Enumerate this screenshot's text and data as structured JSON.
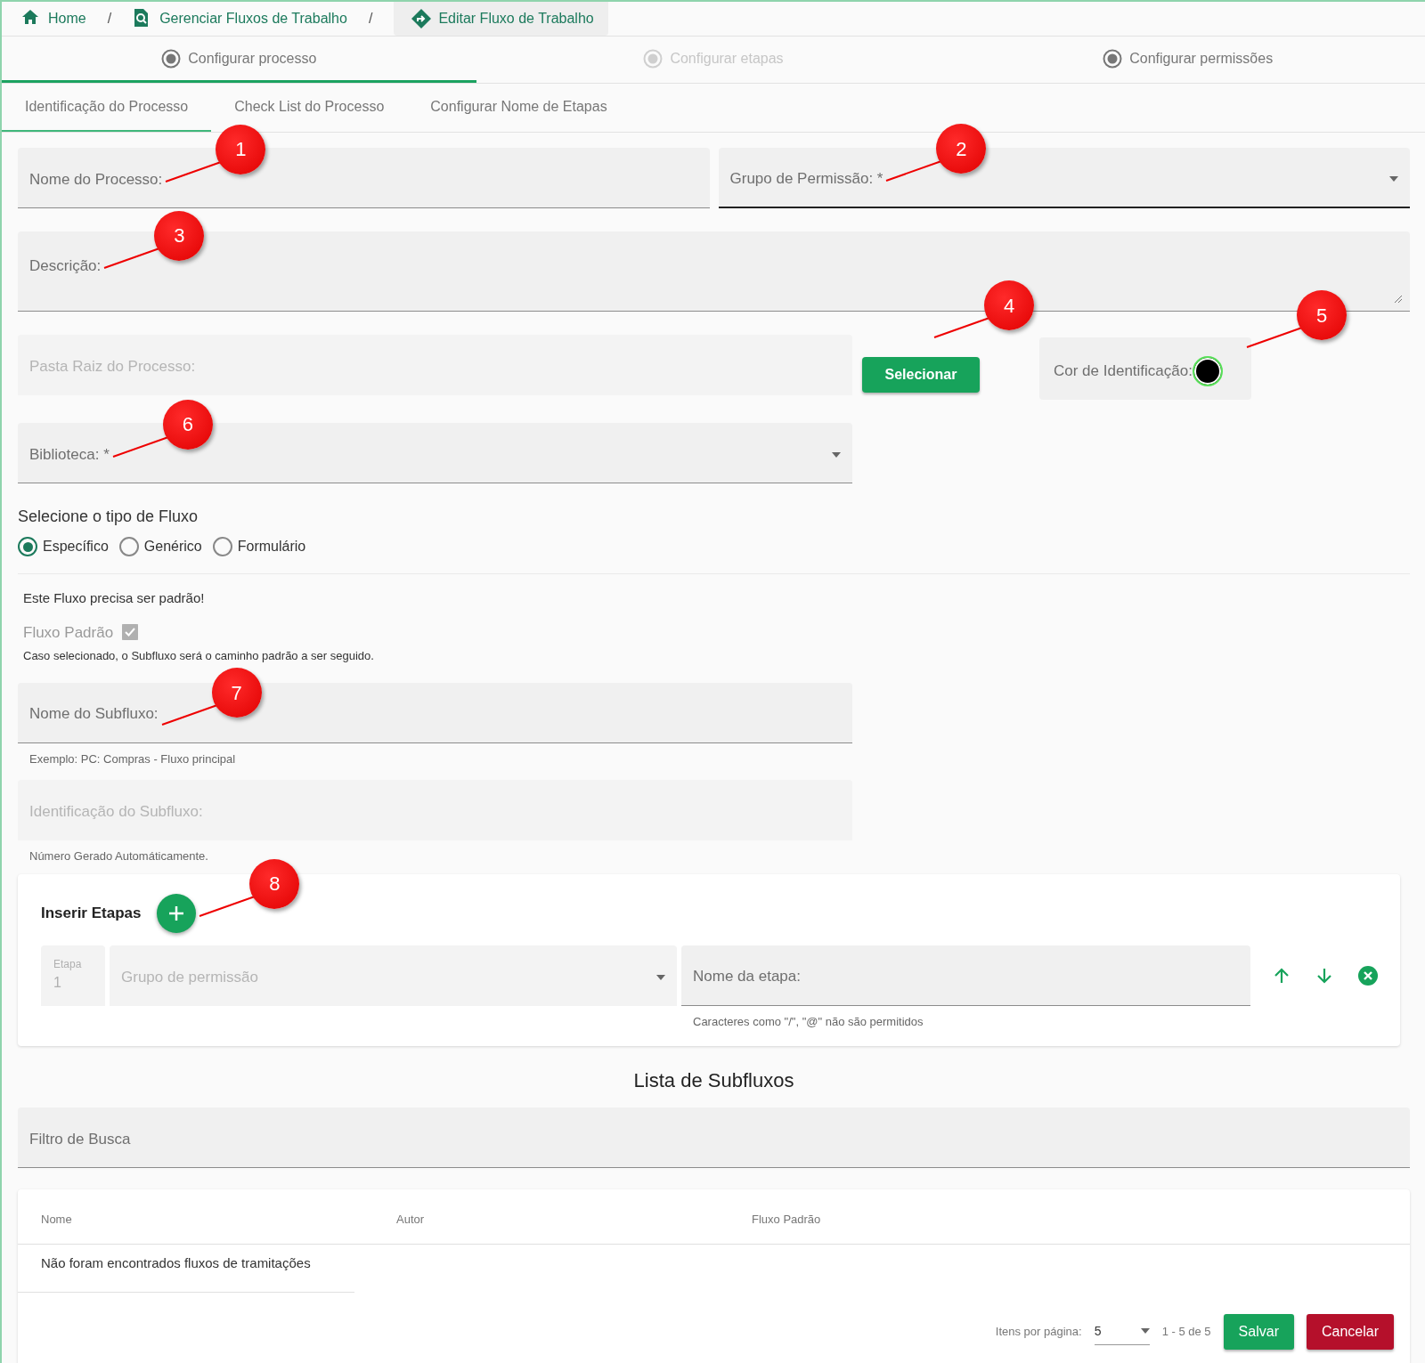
{
  "breadcrumb": [
    {
      "label": "Home",
      "selected": false
    },
    {
      "separator_before": "/",
      "label": "Gerenciar Fluxos de Trabalho",
      "selected": false
    },
    {
      "separator_before": "/",
      "label": "Editar Fluxo de Trabalho",
      "selected": true
    }
  ],
  "stepper": [
    {
      "label": "Configurar processo",
      "selected": true,
      "disabled": false
    },
    {
      "label": "Configurar etapas",
      "selected": false,
      "disabled": true
    },
    {
      "label": "Configurar permissões",
      "selected": false,
      "disabled": false
    }
  ],
  "tabs": [
    {
      "label": "Identificação do Processo",
      "selected": true
    },
    {
      "label": "Check List do Processo",
      "selected": false
    },
    {
      "label": "Configurar Nome de Etapas",
      "selected": false
    }
  ],
  "process_name": {
    "label": "Nome do Processo:",
    "callout": "1"
  },
  "permission_group": {
    "label": "Grupo de Permissão: *",
    "callout": "2"
  },
  "description": {
    "label": "Descrição:",
    "callout": "3"
  },
  "root_folder": {
    "label": "Pasta Raiz do Processo:",
    "disabled": true
  },
  "select_button": {
    "label": "Selecionar",
    "callout": "4"
  },
  "identification_color": {
    "label": "Cor de Identificação:",
    "color": "#000000",
    "callout": "5"
  },
  "library": {
    "label": "Biblioteca: *",
    "callout": "6"
  },
  "flow_type": {
    "title": "Selecione o tipo de Fluxo",
    "options": [
      {
        "label": "Específico",
        "selected": true
      },
      {
        "label": "Genérico",
        "selected": false
      },
      {
        "label": "Formulário",
        "selected": false
      }
    ]
  },
  "default_notice": "Este Fluxo precisa ser padrão!",
  "default_checkbox": {
    "label": "Fluxo Padrão",
    "checked": true,
    "disabled": true
  },
  "default_help": "Caso selecionado, o Subfluxo será o caminho padrão a ser seguido.",
  "subflow_name": {
    "label": "Nome do Subfluxo:",
    "hint": "Exemplo: PC: Compras - Fluxo principal",
    "callout": "7"
  },
  "subflow_id": {
    "label": "Identificação do Subfluxo:",
    "hint": "Número Gerado Automáticamente.",
    "disabled": true
  },
  "steps_card": {
    "title": "Inserir Etapas",
    "callout": "8",
    "rows": [
      {
        "step_label": "Etapa",
        "step_number": "1",
        "group_placeholder": "Grupo de permissão",
        "name_label": "Nome da etapa:",
        "hint": "Caracteres como \"/\", \"@\" não são permitidos"
      }
    ]
  },
  "list_title": "Lista de Subfluxos",
  "search": {
    "label": "Filtro de Busca"
  },
  "table": {
    "columns": [
      "Nome",
      "Autor",
      "Fluxo Padrão"
    ],
    "empty_message": "Não foram encontrados fluxos de tramitações",
    "paginator": {
      "label": "Itens por página:",
      "page_size": "5",
      "range": "1 - 5 de 5"
    }
  },
  "actions": [
    {
      "label": "Salvar",
      "kind": "primary"
    },
    {
      "label": "Cancelar",
      "kind": "danger"
    }
  ]
}
